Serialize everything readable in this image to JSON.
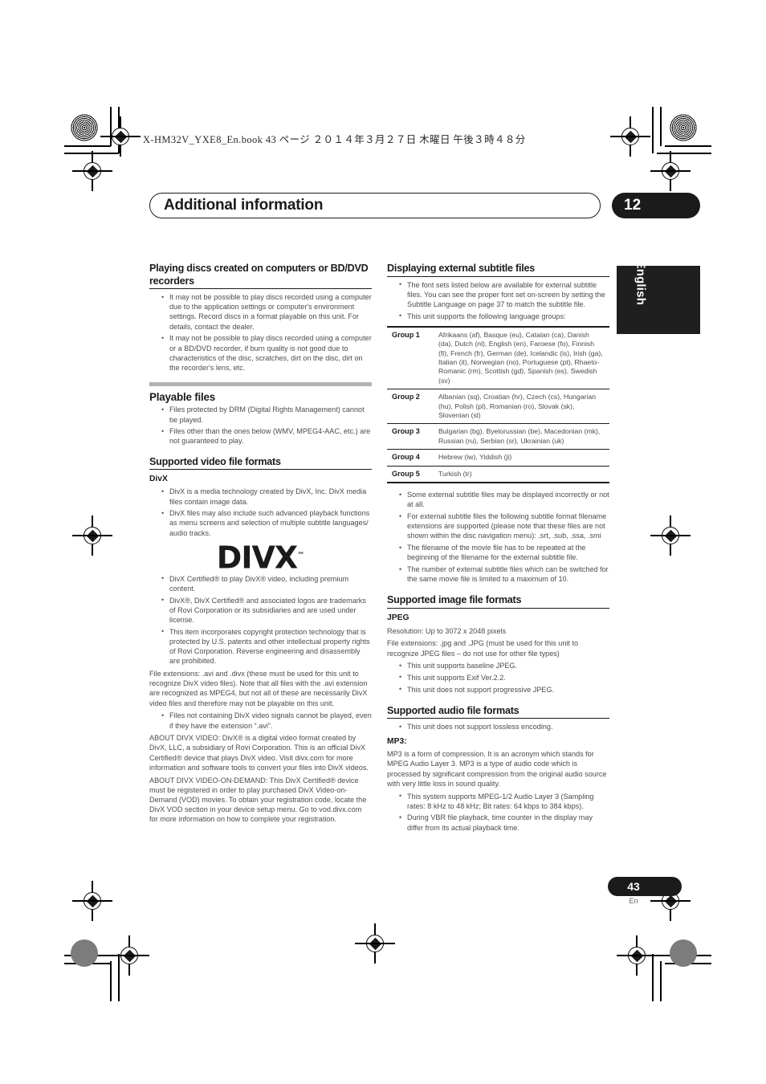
{
  "print_header": {
    "book_line": "X-HM32V_YXE8_En.book   43 ページ   ２０１４年３月２７日   木曜日   午後３時４８分"
  },
  "chapter": {
    "title": "Additional information",
    "number": "12"
  },
  "language_tab": "English",
  "footer": {
    "page_number": "43",
    "language_code": "En"
  },
  "left_column": {
    "s1": {
      "heading": "Playing discs created on computers or BD/DVD recorders",
      "bullets": [
        "It may not be possible to play discs recorded using a computer due to the application settings or computer's environment settings. Record discs in a format playable on this unit. For details, contact the dealer.",
        "It may not be possible to play discs recorded using a computer or a BD/DVD recorder, if burn quality is not good due to characteristics of the disc, scratches, dirt on the disc, dirt on the recorder's lens, etc."
      ]
    },
    "s2": {
      "heading": "Playable files",
      "bullets": [
        "Files protected by DRM (Digital Rights Management) cannot be played.",
        "Files other than the ones below (WMV, MPEG4-AAC, etc.) are not guaranteed to play."
      ]
    },
    "s3": {
      "heading": "Supported video file formats",
      "sub_heading": "DivX",
      "bullets_a": [
        "DivX is a media technology created by DivX, Inc. DivX media files contain image data.",
        "DivX files may also include such advanced playback functions as menu screens and selection of multiple subtitle languages/ audio tracks."
      ],
      "logo_text": "DIVX",
      "logo_tm": "™",
      "bullets_b": [
        "DivX Certified® to play DivX® video, including premium content.",
        "DivX®, DivX Certified® and associated logos are trademarks of Rovi Corporation or its subsidiaries and are used under license.",
        "This item incorporates copyright protection technology that is protected by U.S. patents and other intellectual property rights of Rovi Corporation. Reverse engineering and disassembly are prohibited."
      ],
      "para_extensions": "File extensions: .avi and .divx (these must be used for this unit to recognize DivX video files). Note that all files with the .avi extension are recognized as MPEG4, but not all of these are necessarily DivX video files and therefore may not be playable on this unit.",
      "bullets_c": [
        "Files not containing DivX video signals cannot be played, even if they have the extension “.avi”."
      ],
      "para_about_video": "ABOUT DIVX VIDEO: DivX® is a digital video format created by DivX, LLC, a subsidiary of Rovi Corporation. This is an official DivX Certified® device that plays DivX video. Visit divx.com for more information and software tools to convert your files into DivX videos.",
      "para_about_vod": "ABOUT DIVX VIDEO-ON-DEMAND: This DivX Certified® device must be registered in order to play purchased DivX Video-on-Demand (VOD) movies. To obtain your registration code, locate the DivX VOD section in your device setup menu. Go to vod.divx.com for more information on how to complete your registration."
    }
  },
  "right_column": {
    "s1": {
      "heading": "Displaying external subtitle files",
      "bullets_top": [
        "The font sets listed below are available for external subtitle files. You can see the proper font set on-screen by setting the Subtitle Language on page 37 to match the subtitle file.",
        "This unit supports the following language groups:"
      ],
      "table": {
        "rows": [
          {
            "group": "Group 1",
            "languages": "Afrikaans (af), Basque (eu), Catalan (ca), Danish (da), Dutch (nl), English (en), Faroese (fo), Finnish (fi), French (fr), German (de), Icelandic (is), Irish (ga), Italian (it), Norwegian (no), Portuguese (pt), Rhaeto-Romanic (rm), Scottish (gd), Spanish (es), Swedish (sv)"
          },
          {
            "group": "Group 2",
            "languages": "Albanian (sq), Croatian (hr), Czech (cs), Hungarian (hu), Polish (pl), Romanian (ro), Slovak (sk), Slovenian (sl)"
          },
          {
            "group": "Group 3",
            "languages": "Bulgarian (bg), Byelorussian (be), Macedonian (mk), Russian (ru), Serbian (sr), Ukrainian (uk)"
          },
          {
            "group": "Group 4",
            "languages": "Hebrew (iw), Yiddish (ji)"
          },
          {
            "group": "Group 5",
            "languages": "Turkish (tr)"
          }
        ]
      },
      "bullets_bottom": [
        "Some external subtitle files may be displayed incorrectly or not at all.",
        "For external subtitle files the following subtitle format filename extensions are supported (please note that these files are not shown within the disc navigation menu): .srt, .sub, .ssa, .smi",
        "The filename of the movie file has to be repeated at the beginning of the filename for the external subtitle file.",
        "The number of external subtitle files which can be switched for the same movie file is limited to a maximum of 10."
      ]
    },
    "s2": {
      "heading": "Supported image file formats",
      "sub_heading": "JPEG",
      "para_resolution": "Resolution: Up to 3072 x 2048 pixels",
      "para_extensions": "File extensions: .jpg and .JPG (must be used for this unit to recognize JPEG files – do not use for other file types)",
      "bullets": [
        "This unit supports baseline JPEG.",
        "This unit supports Exif Ver.2.2.",
        "This unit does not support progressive JPEG."
      ]
    },
    "s3": {
      "heading": "Supported audio file formats",
      "bullets_top": [
        "This unit does not support lossless encoding."
      ],
      "sub_heading": "MP3:",
      "para_mp3": "MP3 is a form of compression. It is an acronym which stands for MPEG Audio Layer 3. MP3 is a type of audio code which is processed by significant compression from the original audio source with very little loss in sound quality.",
      "bullets_bottom": [
        "This system supports MPEG-1/2 Audio Layer 3 (Sampling rates: 8 kHz to 48 kHz; Bit rates: 64 kbps to 384 kbps).",
        "During VBR file playback, time counter in the display may differ from its actual playback time."
      ]
    }
  }
}
